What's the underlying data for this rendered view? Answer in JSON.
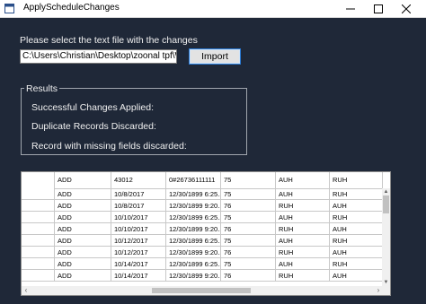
{
  "window": {
    "title": "ApplyScheduleChanges",
    "icon": "app-window-icon"
  },
  "form": {
    "prompt": "Please select the text file with the changes",
    "file_path": "C:\\Users\\Christian\\Desktop\\zoonal tpf\\W",
    "import_label": "Import"
  },
  "results": {
    "legend": "Results",
    "successful": "Successful Changes Applied:",
    "duplicates": "Duplicate Records Discarded:",
    "missing": "Record with missing fields discarded:"
  },
  "grid": {
    "columns": [
      "ADD",
      "43012",
      "0#26736111111",
      "75",
      "AUH",
      "RUH"
    ],
    "rows": [
      [
        "ADD",
        "10/8/2017",
        "12/30/1899 6:25...",
        "75",
        "AUH",
        "RUH"
      ],
      [
        "ADD",
        "10/8/2017",
        "12/30/1899 9:20...",
        "76",
        "RUH",
        "AUH"
      ],
      [
        "ADD",
        "10/10/2017",
        "12/30/1899 6:25...",
        "75",
        "AUH",
        "RUH"
      ],
      [
        "ADD",
        "10/10/2017",
        "12/30/1899 9:20...",
        "76",
        "RUH",
        "AUH"
      ],
      [
        "ADD",
        "10/12/2017",
        "12/30/1899 6:25...",
        "75",
        "AUH",
        "RUH"
      ],
      [
        "ADD",
        "10/12/2017",
        "12/30/1899 9:20...",
        "76",
        "RUH",
        "AUH"
      ],
      [
        "ADD",
        "10/14/2017",
        "12/30/1899 6:25...",
        "75",
        "AUH",
        "RUH"
      ],
      [
        "ADD",
        "10/14/2017",
        "12/30/1899 9:20...",
        "76",
        "RUH",
        "AUH"
      ]
    ]
  }
}
